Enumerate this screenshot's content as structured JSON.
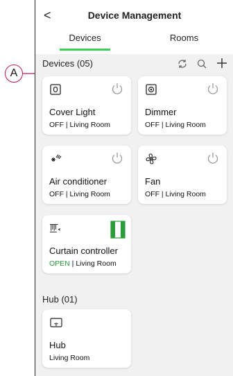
{
  "header": {
    "back_glyph": "<",
    "title": "Device Management",
    "tabs": [
      {
        "label": "Devices",
        "active": true
      },
      {
        "label": "Rooms",
        "active": false
      }
    ],
    "accent_color": "#3dcd58"
  },
  "toolbar": {
    "icons": [
      "refresh-icon",
      "search-icon",
      "add-icon"
    ]
  },
  "callout": {
    "label": "A",
    "color": "#c2185b"
  },
  "devices_section": {
    "title": "Devices (05)",
    "cards": [
      {
        "name": "Cover Light",
        "state": "OFF",
        "room": " | Living Room",
        "icon": "cover-light-icon"
      },
      {
        "name": "Dimmer",
        "state": "OFF",
        "room": " | Living Room",
        "icon": "dimmer-icon"
      },
      {
        "name": "Air conditioner",
        "state": "OFF",
        "room": " | Living Room",
        "icon": "air-conditioner-icon"
      },
      {
        "name": "Fan",
        "state": "OFF",
        "room": " | Living Room",
        "icon": "fan-icon"
      },
      {
        "name": "Curtain controller",
        "state": "OPEN",
        "room": " | Living Room",
        "icon": "curtain-icon"
      }
    ]
  },
  "hub_section": {
    "title": "Hub (01)",
    "cards": [
      {
        "name": "Hub",
        "room": "Living Room",
        "icon": "hub-icon"
      }
    ]
  }
}
